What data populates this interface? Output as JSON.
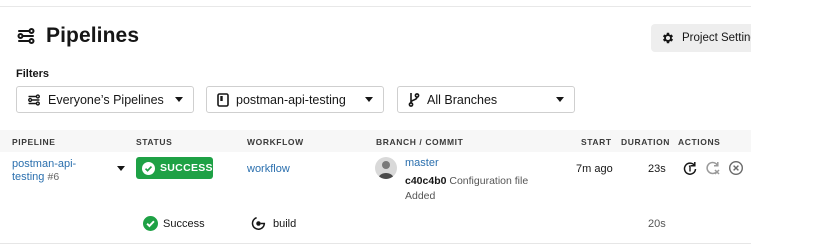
{
  "page": {
    "title": "Pipelines",
    "project_settings_label": "Project Settings"
  },
  "filters": {
    "label": "Filters",
    "pipelines_filter": "Everyone’s Pipelines",
    "project_filter": "postman-api-testing",
    "branch_filter": "All Branches"
  },
  "table": {
    "headers": {
      "pipeline": "PIPELINE",
      "status": "STATUS",
      "workflow": "WORKFLOW",
      "branch_commit": "BRANCH / COMMIT",
      "start": "START",
      "duration": "DURATION",
      "actions": "ACTIONS"
    },
    "rows": [
      {
        "pipeline_name": "postman-api-testing",
        "pipeline_number": "#6",
        "status": "SUCCESS",
        "workflow": "workflow",
        "branch": "master",
        "commit_sha": "c40c4b0",
        "commit_message": "Configuration file Added",
        "start": "7m ago",
        "duration": "23s",
        "jobs": [
          {
            "status": "Success",
            "name": "build",
            "duration": "20s"
          }
        ]
      }
    ]
  },
  "colors": {
    "success": "#1ea145",
    "link": "#2a6fae"
  },
  "icons": {
    "title": "pipelines-icon",
    "settings": "gear-icon",
    "rerun": "rerun-icon",
    "rerun_failed": "rerun-failed-icon",
    "cancel": "cancel-icon"
  }
}
